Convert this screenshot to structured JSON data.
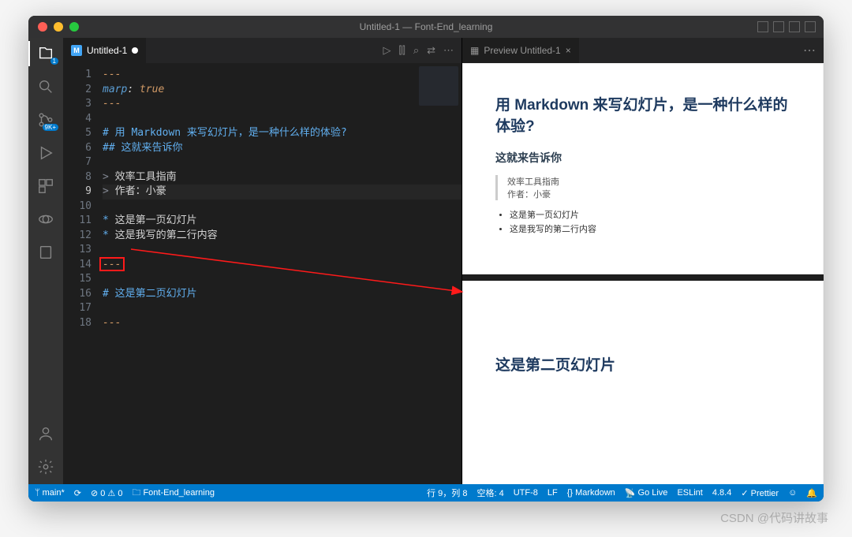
{
  "window": {
    "title": "Untitled-1 — Font-End_learning"
  },
  "activityBar": {
    "explorerBadge": "1",
    "scmBadge": "9K+"
  },
  "editor": {
    "tab": {
      "label": "Untitled-1"
    },
    "lines": [
      {
        "num": "1",
        "html": "---",
        "cls": "c-gold"
      },
      {
        "num": "2",
        "segs": [
          [
            "marp",
            "c-keyword"
          ],
          [
            ": ",
            ""
          ],
          [
            "true",
            "c-gold"
          ]
        ],
        "italic": true
      },
      {
        "num": "3",
        "html": "---",
        "cls": "c-gold"
      },
      {
        "num": "4",
        "html": ""
      },
      {
        "num": "5",
        "html": "# 用 Markdown 来写幻灯片，是一种什么样的体验?",
        "cls": "c-blue"
      },
      {
        "num": "6",
        "html": "## 这就来告诉你",
        "cls": "c-blue"
      },
      {
        "num": "7",
        "html": ""
      },
      {
        "num": "8",
        "segs": [
          [
            "> ",
            "c-quote"
          ],
          [
            "效率工具指南",
            ""
          ]
        ]
      },
      {
        "num": "9",
        "segs": [
          [
            "> ",
            "c-quote"
          ],
          [
            "作者：小豪",
            ""
          ]
        ],
        "current": true
      },
      {
        "num": "10",
        "html": ""
      },
      {
        "num": "11",
        "segs": [
          [
            "* ",
            "c-blue"
          ],
          [
            "这是第一页幻灯片",
            ""
          ]
        ]
      },
      {
        "num": "12",
        "segs": [
          [
            "* ",
            "c-blue"
          ],
          [
            "这是我写的第二行内容",
            ""
          ]
        ]
      },
      {
        "num": "13",
        "html": ""
      },
      {
        "num": "14",
        "html": "---",
        "cls": "c-gold",
        "redbox": true
      },
      {
        "num": "15",
        "html": ""
      },
      {
        "num": "16",
        "html": "# 这是第二页幻灯片",
        "cls": "c-blue"
      },
      {
        "num": "17",
        "html": ""
      },
      {
        "num": "18",
        "html": "---",
        "cls": "c-gold"
      }
    ]
  },
  "preview": {
    "tab": {
      "label": "Preview Untitled-1"
    },
    "slide1": {
      "h1": "用 Markdown 来写幻灯片，是一种什么样的体验?",
      "h2": "这就来告诉你",
      "quote1": "效率工具指南",
      "quote2": "作者：小豪",
      "li1": "这是第一页幻灯片",
      "li2": "这是我写的第二行内容"
    },
    "slide2": {
      "h1": "这是第二页幻灯片"
    }
  },
  "status": {
    "branch": "main*",
    "sync": "⟳",
    "problems": "⊘ 0 ⚠ 0",
    "folder": "Font-End_learning",
    "cursor": "行 9，列 8",
    "spaces": "空格: 4",
    "encoding": "UTF-8",
    "eol": "LF",
    "lang": "Markdown",
    "golive": "Go Live",
    "eslint": "ESLint",
    "version": "4.8.4",
    "prettier": "✓ Prettier"
  },
  "watermark": "CSDN @代码讲故事"
}
